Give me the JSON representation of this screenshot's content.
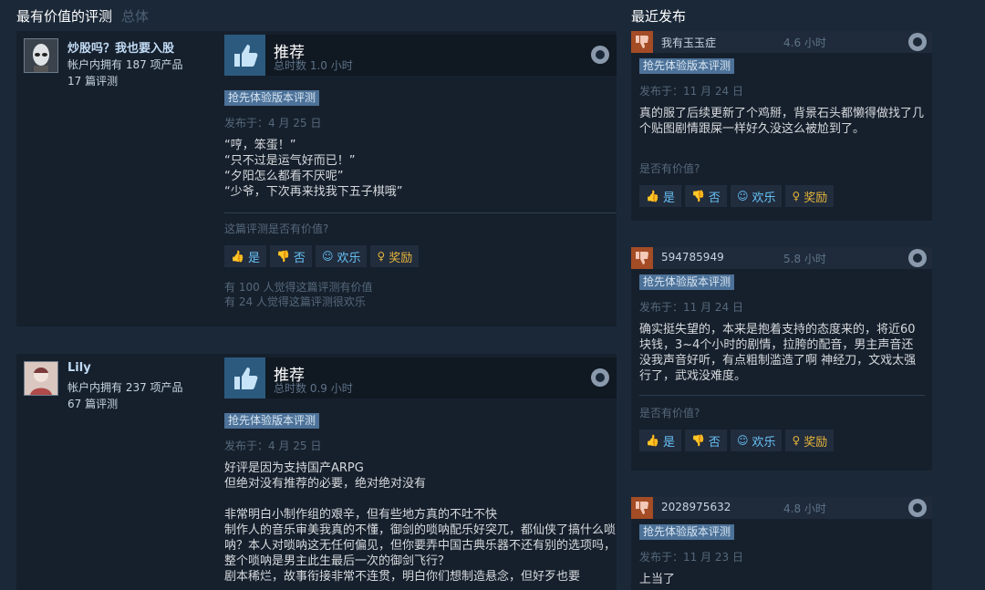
{
  "header_left": {
    "title": "最有价值的评测",
    "sub": "总体"
  },
  "header_right": {
    "title": "最近发布"
  },
  "common": {
    "ea_badge": "抢先体验版本评测",
    "helpful_question": "这篇评测是否有价值?",
    "helpful_question_short": "是否有价值?",
    "yes": "是",
    "no": "否",
    "funny": "欢乐",
    "award": "奖励",
    "recommended": "推荐"
  },
  "reviews": [
    {
      "author": "炒股吗？我也要入股",
      "products": "帐户内拥有 187 项产品",
      "review_count": "17 篇评测",
      "hours": "总时数 1.0 小时",
      "posted": "发布于：4 月 25 日",
      "text": "“哼，笨蛋！”\n“只不过是运气好而已！”\n“夕阳怎么都看不厌呢”\n“少爷，下次再来找我下五子棋哦”",
      "helpful_count": "有 100 人觉得这篇评测有价值",
      "funny_count": "有 24 人觉得这篇评测很欢乐"
    },
    {
      "author": "Lily",
      "products": "帐户内拥有 237 项产品",
      "review_count": "67 篇评测",
      "hours": "总时数 0.9 小时",
      "posted": "发布于：4 月 25 日",
      "text": "好评是因为支持国产ARPG\n但绝对没有推荐的必要，绝对绝对没有\n\n非常明白小制作组的艰辛，但有些地方真的不吐不快\n制作人的音乐审美我真的不懂，御剑的唢呐配乐好突兀，都仙侠了搞什么唢呐？本人对唢呐这无任何偏见，但你要弄中国古典乐器不还有别的选项吗，整个唢呐是男主此生最后一次的御剑飞行？\n剧本稀烂，故事衔接非常不连贯，明白你们想制造悬念，但好歹也要"
    }
  ],
  "recent": [
    {
      "name": "我有玉玉症",
      "hours": "4.6 小时",
      "posted": "发布于：11 月 24 日",
      "text": "真的服了后续更新了个鸡掰，背景石头都懒得做找了几个贴图剧情跟屎一样好久没这么被尬到了。"
    },
    {
      "name": "594785949",
      "hours": "5.8 小时",
      "posted": "发布于：11 月 24 日",
      "text": "确实挺失望的，本来是抱着支持的态度来的，将近60块钱，3~4个小时的剧情，拉胯的配音，男主声音还没我声音好听，有点粗制滥造了啊 神经刀，文戏太强行了，武戏没难度。"
    },
    {
      "name": "2028975632",
      "hours": "4.8 小时",
      "posted": "发布于：11 月 23 日",
      "text": "上当了"
    }
  ]
}
